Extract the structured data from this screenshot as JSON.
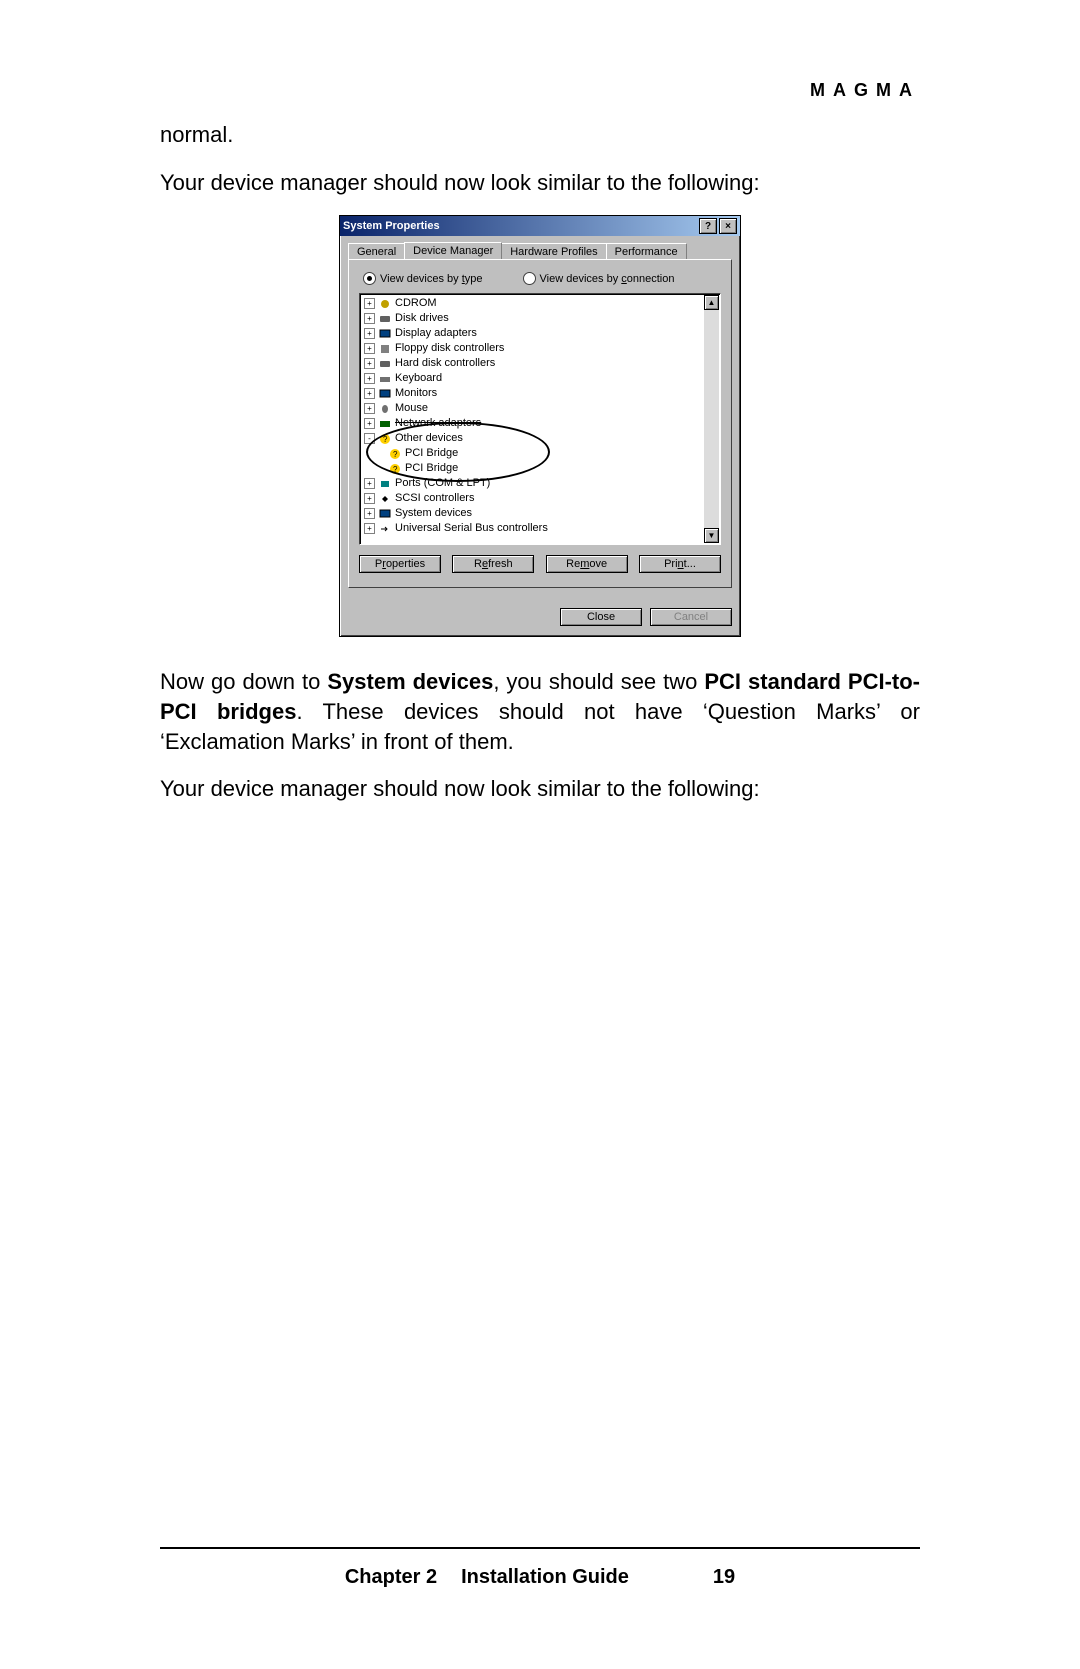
{
  "brand": "MAGMA",
  "para1": "normal.",
  "para2": "Your device manager should now look similar to the following:",
  "para3_a": "Now go down to ",
  "para3_b": "System devices",
  "para3_c": ", you should see two ",
  "para3_d": "PCI standard PCI-to-PCI bridges",
  "para3_e": ". These devices should not have ‘Question Marks’ or ‘Exclamation Marks’ in front of them.",
  "para4": "Your device manager should now look similar to the following:",
  "footer": {
    "chapter": "Chapter 2",
    "title": "Installation Guide",
    "page": "19"
  },
  "dialog": {
    "title": "System Properties",
    "help": "?",
    "close": "×",
    "tabs": {
      "general": "General",
      "devmgr": "Device Manager",
      "hw": "Hardware Profiles",
      "perf": "Performance"
    },
    "view_by_type": "View devices by type",
    "view_by_conn": "View devices by connection",
    "tree": {
      "cdrom": "CDROM",
      "disk": "Disk drives",
      "display": "Display adapters",
      "floppy": "Floppy disk controllers",
      "hdd": "Hard disk controllers",
      "keyboard": "Keyboard",
      "monitors": "Monitors",
      "mouse": "Mouse",
      "network": "Network adapters",
      "other": "Other devices",
      "pci1": "PCI Bridge",
      "pci2": "PCI Bridge",
      "ports": "Ports (COM & LPT)",
      "scsi": "SCSI controllers",
      "sysdev": "System devices",
      "usb": "Universal Serial Bus controllers"
    },
    "buttons": {
      "properties": "Properties",
      "refresh": "Refresh",
      "remove": "Remove",
      "print": "Print...",
      "close": "Close",
      "cancel": "Cancel"
    }
  }
}
